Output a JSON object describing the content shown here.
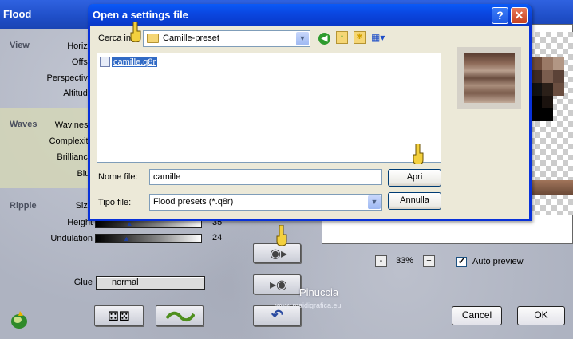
{
  "app": {
    "title": "Flood"
  },
  "sections": {
    "view": "View",
    "waves": "Waves",
    "ripple": "Ripple"
  },
  "labels": {
    "horizon": "Horizo",
    "offset": "Offse",
    "perspective": "Perspective",
    "altitude": "Altitude",
    "waviness": "Waviness",
    "complexity": "Complexity",
    "brilliance": "Brilliance",
    "blur": "Blur",
    "size": "Size",
    "height": "Height",
    "undulation": "Undulation",
    "glue": "Glue"
  },
  "sliders": {
    "height": {
      "value": "35",
      "level": 0.3
    },
    "undulation": {
      "value": "24",
      "level": 0.27
    }
  },
  "glue": {
    "value": "normal"
  },
  "zoom": {
    "minus": "-",
    "value": "33%",
    "plus": "+"
  },
  "auto_preview": {
    "label": "Auto preview",
    "checked": true,
    "mark": "✓"
  },
  "buttons": {
    "cancel": "Cancel",
    "ok": "OK"
  },
  "watermark": {
    "name": "Pinuccia",
    "site": "www.maidigrafica.eu"
  },
  "dialog": {
    "title": "Open a settings file",
    "help": "?",
    "close": "✕",
    "lookin_label": "Cerca in:",
    "folder": "Camille-preset",
    "files": [
      {
        "name": "camille.q8r",
        "selected": true
      }
    ],
    "filename_label": "Nome file:",
    "filename_value": "camille",
    "filetype_label": "Tipo file:",
    "filetype_value": "Flood presets (*.q8r)",
    "open_button": "Apri",
    "cancel_button": "Annulla",
    "toolbar_icons": [
      "back-icon",
      "up-folder-icon",
      "new-folder-icon",
      "view-menu-icon"
    ]
  },
  "colors": {
    "titlebar": "#1f4ec7",
    "dialog_title": "#0a46e0",
    "selection": "#316ac5"
  }
}
